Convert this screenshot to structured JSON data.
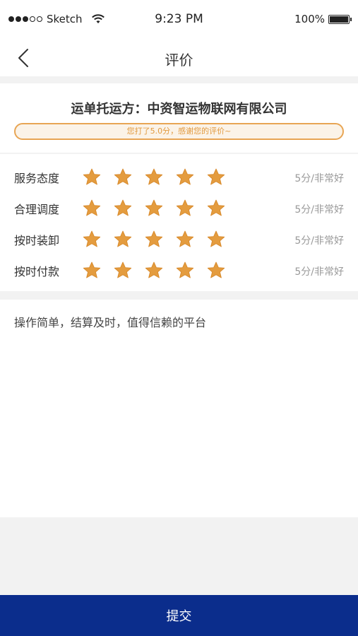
{
  "status_bar": {
    "carrier": "Sketch",
    "time": "9:23 PM",
    "battery_text": "100%"
  },
  "nav": {
    "title": "评价",
    "back_icon": "chevron-left-icon"
  },
  "company": {
    "name": "运单托运方：中资智运物联网有限公司",
    "thanks_text": "您打了5.0分，感谢您的评价~"
  },
  "ratings": [
    {
      "label": "服务态度",
      "score": 5,
      "max": 5,
      "value_text": "5分/非常好"
    },
    {
      "label": "合理调度",
      "score": 5,
      "max": 5,
      "value_text": "5分/非常好"
    },
    {
      "label": "按时装卸",
      "score": 5,
      "max": 5,
      "value_text": "5分/非常好"
    },
    {
      "label": "按时付款",
      "score": 5,
      "max": 5,
      "value_text": "5分/非常好"
    }
  ],
  "comment": {
    "text": "操作简单，结算及时，值得信赖的平台"
  },
  "submit": {
    "label": "提交"
  },
  "colors": {
    "star": "#e49c3f",
    "accent": "#e8a554",
    "submit_bg": "#0b2d8c"
  }
}
